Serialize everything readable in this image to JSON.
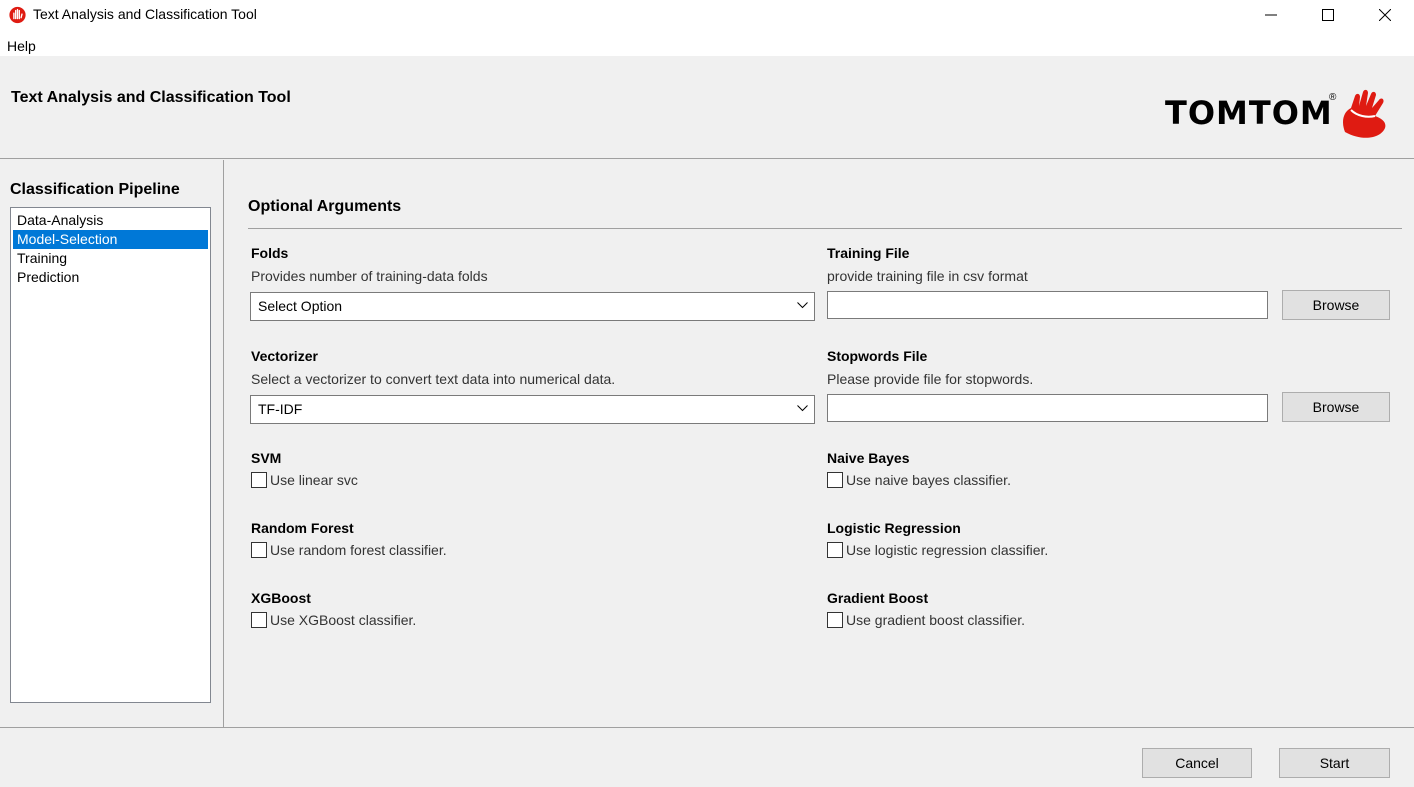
{
  "window": {
    "title": "Text Analysis and Classification Tool",
    "icon": "tomtom-hand-icon",
    "controls": [
      "minimize-icon",
      "maximize-icon",
      "close-icon"
    ]
  },
  "menu": {
    "items": [
      "Help"
    ]
  },
  "header": {
    "title": "Text Analysis and Classification Tool",
    "logo_text": "TOMTOM",
    "logo_mark": "®",
    "brand_color": "#df1b12"
  },
  "sidebar": {
    "title": "Classification Pipeline",
    "items": [
      {
        "label": "Data-Analysis",
        "selected": false
      },
      {
        "label": "Model-Selection",
        "selected": true
      },
      {
        "label": "Training",
        "selected": false
      },
      {
        "label": "Prediction",
        "selected": false
      }
    ],
    "selection_color": "#0078d7"
  },
  "main": {
    "section_title": "Optional Arguments",
    "folds": {
      "label": "Folds",
      "description": "Provides number of training-data folds",
      "value": "Select Option"
    },
    "training_file": {
      "label": "Training File",
      "description": "provide training file in csv format",
      "value": "",
      "browse_label": "Browse"
    },
    "vectorizer": {
      "label": "Vectorizer",
      "description": "Select a vectorizer to convert text data into numerical data.",
      "value": "TF-IDF"
    },
    "stopwords_file": {
      "label": "Stopwords File",
      "description": "Please provide file for stopwords.",
      "value": "",
      "browse_label": "Browse"
    },
    "svm": {
      "label": "SVM",
      "option": "Use linear svc",
      "checked": false
    },
    "naive_bayes": {
      "label": "Naive Bayes",
      "option": "Use naive bayes classifier.",
      "checked": false
    },
    "random_forest": {
      "label": "Random Forest",
      "option": "Use random forest classifier.",
      "checked": false
    },
    "logistic_regression": {
      "label": "Logistic Regression",
      "option": "Use logistic regression classifier.",
      "checked": false
    },
    "xgboost": {
      "label": "XGBoost",
      "option": "Use XGBoost classifier.",
      "checked": false
    },
    "gradient_boost": {
      "label": "Gradient Boost",
      "option": "Use gradient boost classifier.",
      "checked": false
    }
  },
  "footer": {
    "cancel_label": "Cancel",
    "start_label": "Start"
  }
}
